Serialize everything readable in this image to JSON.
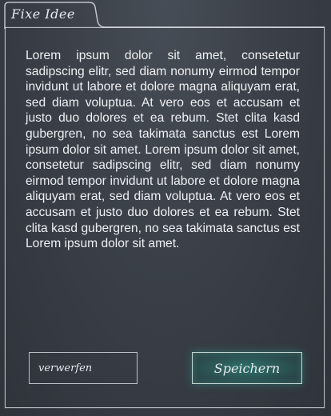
{
  "window": {
    "tab_title": "Fixe Idee"
  },
  "note": {
    "body": "Lorem ipsum dolor sit amet, consetetur sadipscing elitr, sed diam nonumy eirmod tempor invidunt ut labore et dolore magna aliquyam erat, sed diam voluptua. At vero eos et accusam et justo duo dolores et ea rebum. Stet clita kasd gubergren, no sea takimata sanctus est Lorem ipsum dolor sit amet. Lorem ipsum dolor sit amet, consetetur sadipscing elitr, sed diam nonumy eirmod tempor invidunt ut labore et dolore magna aliquyam erat, sed diam voluptua. At vero eos et accusam et justo duo dolores et ea rebum. Stet clita kasd gubergren, no sea takimata sanctus est Lorem ipsum dolor sit amet."
  },
  "actions": {
    "discard_label": "verwerfen",
    "save_label": "Speichern"
  },
  "colors": {
    "background": "#3b4048",
    "chalk": "#e6e8ec",
    "save_accent": "#28a08c"
  }
}
